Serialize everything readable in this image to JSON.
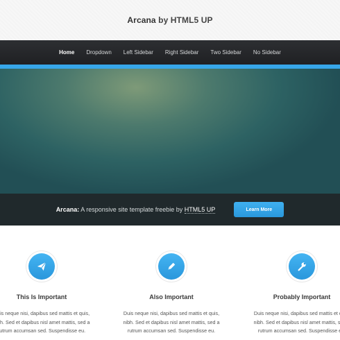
{
  "header": {
    "brand": "Arcana",
    "byline": " by HTML5 UP"
  },
  "nav": {
    "items": [
      {
        "label": "Home",
        "active": true
      },
      {
        "label": "Dropdown",
        "active": false
      },
      {
        "label": "Left Sidebar",
        "active": false
      },
      {
        "label": "Right Sidebar",
        "active": false
      },
      {
        "label": "Two Sidebar",
        "active": false
      },
      {
        "label": "No Sidebar",
        "active": false
      }
    ]
  },
  "cta": {
    "brand": "Arcana:",
    "text": " A responsive site template freebie by ",
    "link": "HTML5 UP",
    "button": "Learn More"
  },
  "features": [
    {
      "icon": "paper-plane-icon",
      "title": "This Is Important",
      "lines": [
        "Duis neque nisi, dapibus sed mattis et quis,",
        "nibh. Sed et dapibus nisl amet mattis, sed a",
        "rutrum accumsan sed. Suspendisse eu."
      ]
    },
    {
      "icon": "pencil-icon",
      "title": "Also Important",
      "lines": [
        "Duis neque nisi, dapibus sed mattis et quis,",
        "nibh. Sed et dapibus nisl amet mattis, sed a",
        "rutrum accumsan sed. Suspendisse eu."
      ]
    },
    {
      "icon": "wrench-icon",
      "title": "Probably Important",
      "lines": [
        "Duis neque nisi, dapibus sed mattis et quis,",
        "nibh. Sed et dapibus nisl amet mattis, sed a",
        "rutrum accumsan sed. Suspendisse eu."
      ]
    }
  ],
  "colors": {
    "accent": "#37a6e9",
    "nav_background": "#2a2c2f",
    "cta_background": "#20292c"
  }
}
